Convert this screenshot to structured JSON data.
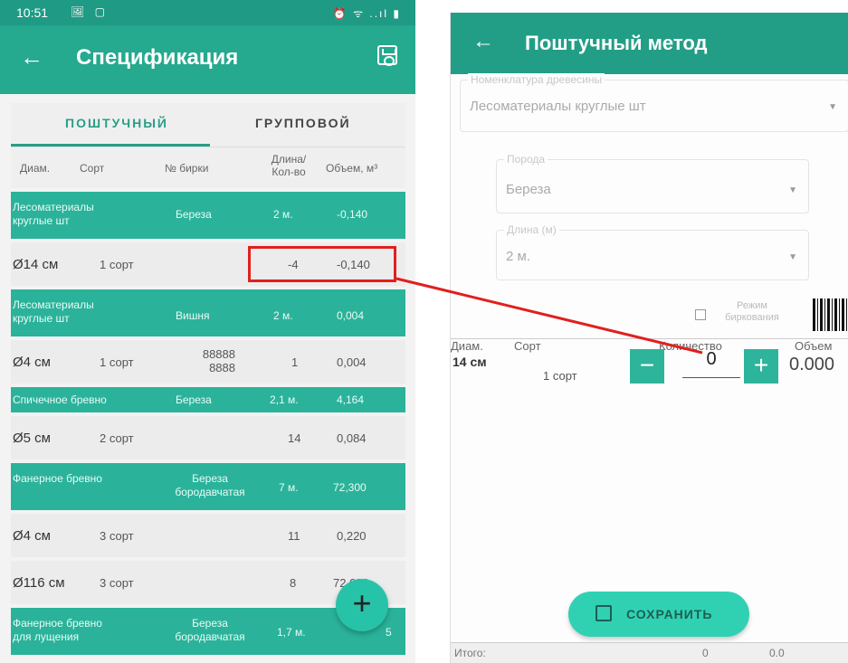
{
  "left": {
    "status": {
      "time": "10:51",
      "icons_left": "🖼 ▢",
      "icons_right": "⏰ ᯤ ..ıl ▮"
    },
    "appbar": {
      "back": "←",
      "title": "Спецификация"
    },
    "tabs": {
      "tab1": "ПОШТУЧНЫЙ",
      "tab2": "ГРУППОВОЙ"
    },
    "headers": {
      "diam": "Диам.",
      "sort": "Сорт",
      "tag": "№ бирки",
      "len": "Длина/ Кол-во",
      "vol": "Объем, м³"
    },
    "rows": [
      {
        "type": "group",
        "name": "Лесоматериалы круглые шт",
        "species": "Береза",
        "len": "2 м.",
        "vol": "-0,140"
      },
      {
        "type": "item",
        "diam": "Ø14 см",
        "sort": "1 сорт",
        "tag": "",
        "qty": "-4",
        "vol": "-0,140"
      },
      {
        "type": "group",
        "name": "Лесоматериалы круглые шт",
        "species": "Вишня",
        "len": "2 м.",
        "vol": "0,004"
      },
      {
        "type": "item",
        "diam": "Ø4 см",
        "sort": "1 сорт",
        "tag": "88888 8888",
        "qty": "1",
        "vol": "0,004"
      },
      {
        "type": "group",
        "name": "Спичечное бревно",
        "species": "Береза",
        "len": "2,1 м.",
        "vol": "4,164"
      },
      {
        "type": "item",
        "diam": "Ø5 см",
        "sort": "2 сорт",
        "tag": "",
        "qty": "14",
        "vol": "0,084"
      },
      {
        "type": "group",
        "name": "Фанерное бревно",
        "species": "Береза бородавчатая",
        "len": "7 м.",
        "vol": "72,300"
      },
      {
        "type": "item",
        "diam": "Ø4 см",
        "sort": "3 сорт",
        "tag": "",
        "qty": "11",
        "vol": "0,220"
      },
      {
        "type": "item",
        "diam": "Ø116 см",
        "sort": "3 сорт",
        "tag": "",
        "qty": "8",
        "vol": "72,080"
      },
      {
        "type": "group",
        "name": "Фанерное бревно для лущения",
        "species": "Береза бородавчатая",
        "len": "1,7 м.",
        "vol": "5"
      }
    ],
    "fab": "+"
  },
  "right": {
    "appbar": {
      "back": "←",
      "title": "Поштучный метод"
    },
    "nomenclature": {
      "label": "Номенклатура древесины",
      "value": "Лесоматериалы круглые шт"
    },
    "breed": {
      "label": "Порода",
      "value": "Береза"
    },
    "length": {
      "label": "Длина (м)",
      "value": "2 м."
    },
    "tag_mode": "Режим биркования",
    "columns": {
      "diam": "Диам.",
      "sort": "Сорт",
      "qty": "Количество",
      "vol": "Объем"
    },
    "row": {
      "diam": "14 см",
      "sort": "1 сорт",
      "minus": "−",
      "qty": "0",
      "plus": "+",
      "vol": "0.000"
    },
    "save": "СОХРАНИТЬ",
    "total": {
      "label": "Итого:",
      "qty": "0",
      "vol": "0.0"
    }
  },
  "colors": {
    "appbar": "#25a98f",
    "group_row": "#2ab39a",
    "fab": "#27c3a8",
    "highlight": "#e0201e"
  }
}
